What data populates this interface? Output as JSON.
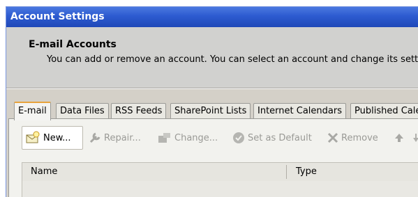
{
  "window": {
    "title": "Account Settings"
  },
  "header": {
    "title": "E-mail Accounts",
    "description": "You can add or remove an account. You can select an account and change its sett"
  },
  "tabs": [
    {
      "label": "E-mail",
      "active": true
    },
    {
      "label": "Data Files"
    },
    {
      "label": "RSS Feeds"
    },
    {
      "label": "SharePoint Lists"
    },
    {
      "label": "Internet Calendars"
    },
    {
      "label": "Published Cale"
    }
  ],
  "toolbar": {
    "new_label": "New...",
    "repair_label": "Repair...",
    "change_label": "Change...",
    "default_label": "Set as Default",
    "remove_label": "Remove"
  },
  "list": {
    "columns": [
      "Name",
      "Type"
    ]
  },
  "colors": {
    "title_bar": "#2d5bd0",
    "active_tab_accent": "#e8a33c",
    "disabled_text": "#9a9a96"
  }
}
